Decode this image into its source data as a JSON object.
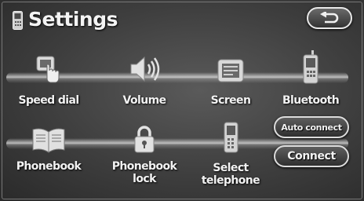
{
  "header": {
    "title": "Settings"
  },
  "menu": {
    "speed_dial": "Speed dial",
    "volume": "Volume",
    "screen": "Screen",
    "bluetooth": "Bluetooth",
    "phonebook": "Phonebook",
    "phonebook_lock_line1": "Phonebook",
    "phonebook_lock_line2": "lock",
    "select_telephone_line1": "Select",
    "select_telephone_line2": "telephone"
  },
  "buttons": {
    "auto_connect": "Auto connect",
    "connect": "Connect"
  },
  "icons": {
    "title": "phone-icon",
    "back": "return-arrow-icon",
    "speed_dial": "speed-dial-icon",
    "volume": "speaker-icon",
    "screen": "screen-icon",
    "bluetooth": "mobile-phone-icon",
    "phonebook": "open-book-icon",
    "phonebook_lock": "padlock-icon",
    "select_telephone": "mobile-phone-icon"
  },
  "colors": {
    "background": "#3e3e3e",
    "text": "#f2f2f2",
    "button_border": "#dcdcdc"
  }
}
